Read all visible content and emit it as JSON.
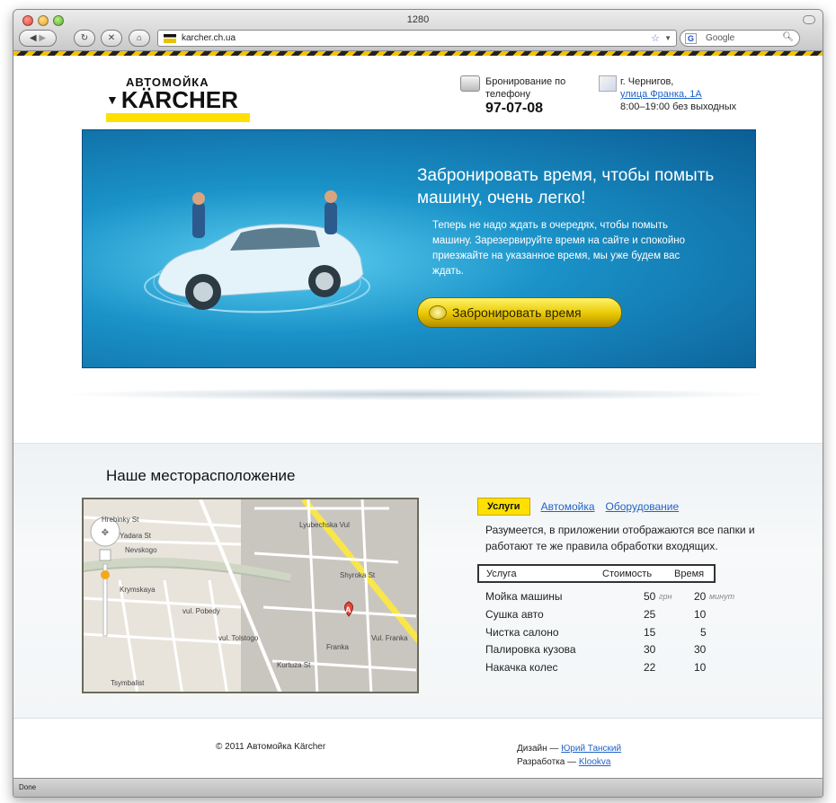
{
  "browser": {
    "window_title": "1280",
    "url": "karcher.ch.ua",
    "search_placeholder": "Google",
    "status": "Done"
  },
  "header": {
    "logo_top": "АВТОМОЙКА",
    "logo_main": "KÄRCHER",
    "phone_label": "Бронирование по телефону",
    "phone_number": "97-07-08",
    "city": "г. Чернигов,",
    "street": "улица Франка, 1А",
    "hours": "8:00–19:00 без выходных"
  },
  "hero": {
    "title": "Забронировать время, чтобы помыть машину, очень легко!",
    "text": "Теперь не надо ждать в очередях, чтобы помыть машину. Зарезервируйте время на сайте и спокойно приезжайте на указанное время, мы уже будем вас ждать.",
    "button": "Забронировать время"
  },
  "location": {
    "title": "Наше месторасположение",
    "map_labels": [
      "Hrebinky St",
      "Yadara St",
      "Nevskogo",
      "Krymskaya",
      "Lyubechska Vul",
      "Shyroka St",
      "Vul. Franka",
      "Tsymbalist",
      "vul. Pobedy",
      "vul. Tolstogo",
      "Kurtuza St",
      "Franka"
    ],
    "map_pin": "A"
  },
  "services": {
    "tabs": [
      "Услуги",
      "Автомойка",
      "Оборудование"
    ],
    "description": "Разумеется, в приложении отображаются все папки и работают те же правила обработки входящих.",
    "columns": [
      "Услуга",
      "Стоимость",
      "Время"
    ],
    "rows": [
      {
        "name": "Мойка машины",
        "price": "50",
        "price_unit": "грн",
        "time": "20",
        "time_unit": "минут"
      },
      {
        "name": "Сушка авто",
        "price": "25",
        "price_unit": "",
        "time": "10",
        "time_unit": ""
      },
      {
        "name": "Чистка салоно",
        "price": "15",
        "price_unit": "",
        "time": "5",
        "time_unit": ""
      },
      {
        "name": "Палировка кузова",
        "price": "30",
        "price_unit": "",
        "time": "30",
        "time_unit": ""
      },
      {
        "name": "Накачка колес",
        "price": "22",
        "price_unit": "",
        "time": "10",
        "time_unit": ""
      }
    ]
  },
  "footer": {
    "copyright": "© 2011 Автомойка Kärcher",
    "design_label": "Дизайн —",
    "design_author": "Юрий Танский",
    "dev_label": "Разработка —",
    "dev_author": "Klookva"
  },
  "colors": {
    "accent": "#ffe000",
    "link": "#1e63c8",
    "hero": "#1a92c8"
  }
}
